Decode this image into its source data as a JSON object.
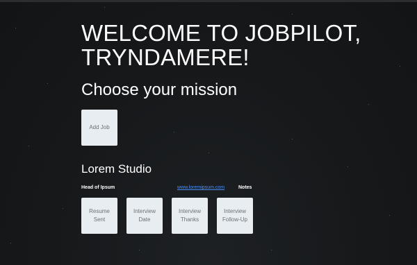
{
  "welcome": {
    "line1": "WELCOME TO JOBPILOT,",
    "line2": "TRYNDAMERE!"
  },
  "mission": {
    "heading": "Choose your mission",
    "add_job_label": "Add Job"
  },
  "job": {
    "company": "Lorem Studio",
    "position": "Head of Ipsum",
    "website": "www.loremipsum.com",
    "notes_label": "Notes",
    "actions": [
      {
        "label": "Resume\nSent"
      },
      {
        "label": "Interview\nDate"
      },
      {
        "label": "Interview\nThanks"
      },
      {
        "label": "Interview\nFollow-Up"
      }
    ]
  },
  "colors": {
    "background": "#16181a",
    "tile": "#e8edf1",
    "link": "#4d8df0",
    "text": "#ffffff"
  }
}
